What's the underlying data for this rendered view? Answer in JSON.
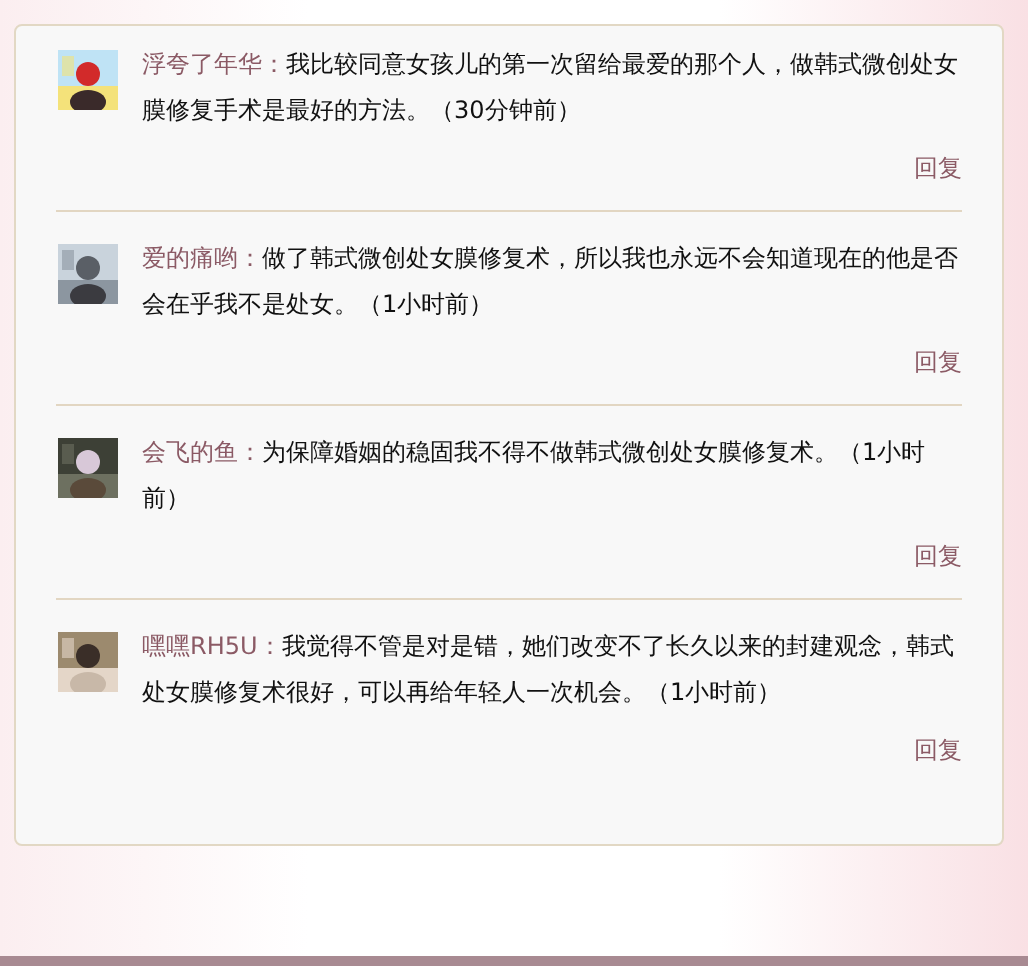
{
  "comments": [
    {
      "author": "浮夸了年华：",
      "text": "我比较同意女孩儿的第一次留给最爱的那个人，做韩式微创处女膜修复手术是最好的方法。",
      "time": "（30分钟前）",
      "reply": "回复"
    },
    {
      "author": "爱的痛哟：",
      "text": "做了韩式微创处女膜修复术，所以我也永远不会知道现在的他是否会在乎我不是处女。",
      "time": "（1小时前）",
      "reply": "回复"
    },
    {
      "author": "会飞的鱼：",
      "text": "为保障婚姻的稳固我不得不做韩式微创处女膜修复术。",
      "time": "（1小时前）",
      "reply": "回复"
    },
    {
      "author": "嘿嘿RH5U：",
      "text": "我觉得不管是对是错，她们改变不了长久以来的封建观念，韩式处女膜修复术很好，可以再给年轻人一次机会。",
      "time": "（1小时前）",
      "reply": "回复"
    }
  ]
}
